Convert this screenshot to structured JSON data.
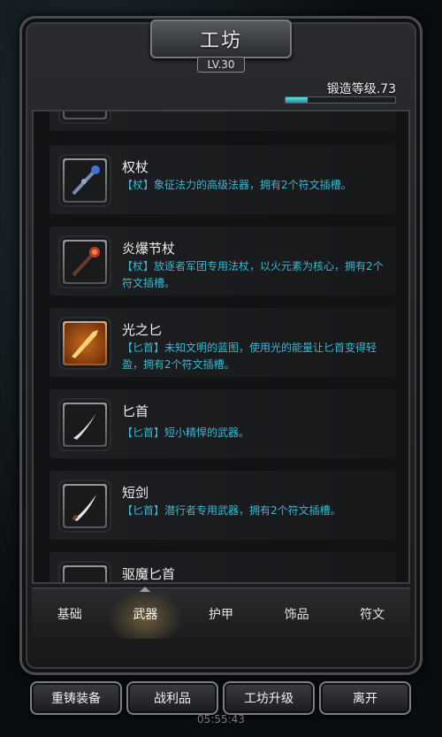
{
  "header": {
    "title": "工坊",
    "level": "LV.30"
  },
  "forge": {
    "label": "锻造等级.73",
    "progress": 0.2
  },
  "items": [
    {
      "name": "权杖",
      "desc": "【杖】象征法力的高级法器，拥有2个符文插槽。",
      "icon": "scepter-icon",
      "rarity": "normal"
    },
    {
      "name": "炎爆节杖",
      "desc": "【杖】放逐者军团专用法杖，以火元素为核心，拥有2个符文插槽。",
      "icon": "fire-staff-icon",
      "rarity": "normal"
    },
    {
      "name": "光之匕",
      "desc": "【匕首】未知文明的蓝图，使用光的能量让匕首变得轻盈，拥有2个符文插槽。",
      "icon": "light-dagger-icon",
      "rarity": "orange"
    },
    {
      "name": "匕首",
      "desc": "【匕首】短小精悍的武器。",
      "icon": "dagger-icon",
      "rarity": "normal"
    },
    {
      "name": "短剑",
      "desc": "【匕首】潜行者专用武器，拥有2个符文插槽。",
      "icon": "short-sword-icon",
      "rarity": "normal"
    },
    {
      "name": "驱魔匕首",
      "desc": "",
      "icon": "exorcism-dagger-icon",
      "rarity": "normal"
    }
  ],
  "tabs": [
    {
      "label": "基础",
      "active": false
    },
    {
      "label": "武器",
      "active": true
    },
    {
      "label": "护甲",
      "active": false
    },
    {
      "label": "饰品",
      "active": false
    },
    {
      "label": "符文",
      "active": false
    }
  ],
  "bottom_buttons": [
    {
      "label": "重铸装备"
    },
    {
      "label": "战利品"
    },
    {
      "label": "工坊升级"
    },
    {
      "label": "离开"
    }
  ],
  "clock": "05:55:43",
  "colors": {
    "desc": "#3bb7ce",
    "progress": "#3cc6cf",
    "orange_frame": "#c66a1a"
  }
}
